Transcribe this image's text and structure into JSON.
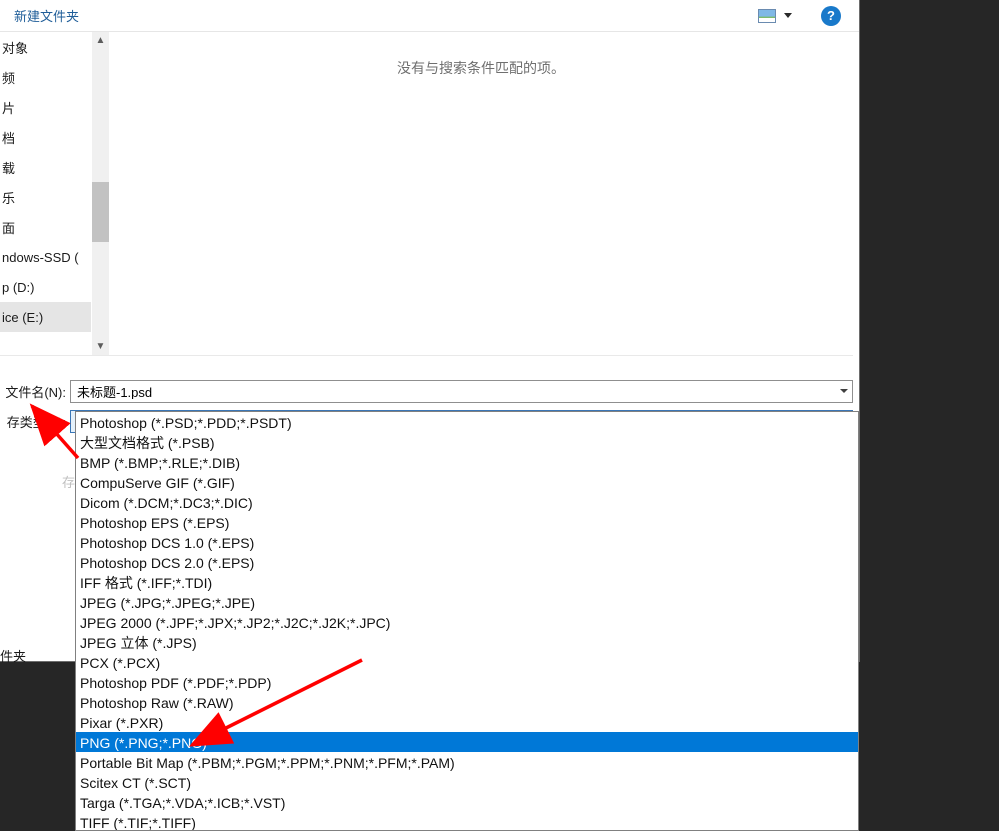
{
  "toolbar": {
    "new_folder": "新建文件夹"
  },
  "content": {
    "empty_message": "没有与搜索条件匹配的项。"
  },
  "nav": {
    "items": [
      " 对象",
      "频",
      "片",
      "档",
      "载",
      "乐",
      "面",
      "ndows-SSD (",
      "p (D:)",
      "ice (E:)"
    ],
    "selected_index": 9
  },
  "form": {
    "filename_label": "文件名(N):",
    "filename_value": "未标题-1.psd",
    "savetype_label": "存类型(T):",
    "savetype_value": "Photoshop (*.PSD;*.PDD;*.PSDT)",
    "hidden_char": "存",
    "side_label": "件夹"
  },
  "dropdown": {
    "highlight_index": 16,
    "options": [
      "Photoshop (*.PSD;*.PDD;*.PSDT)",
      "大型文档格式 (*.PSB)",
      "BMP (*.BMP;*.RLE;*.DIB)",
      "CompuServe GIF (*.GIF)",
      "Dicom (*.DCM;*.DC3;*.DIC)",
      "Photoshop EPS (*.EPS)",
      "Photoshop DCS 1.0 (*.EPS)",
      "Photoshop DCS 2.0 (*.EPS)",
      "IFF 格式 (*.IFF;*.TDI)",
      "JPEG (*.JPG;*.JPEG;*.JPE)",
      "JPEG 2000 (*.JPF;*.JPX;*.JP2;*.J2C;*.J2K;*.JPC)",
      "JPEG 立体 (*.JPS)",
      "PCX (*.PCX)",
      "Photoshop PDF (*.PDF;*.PDP)",
      "Photoshop Raw (*.RAW)",
      "Pixar (*.PXR)",
      "PNG (*.PNG;*.PNG)",
      "Portable Bit Map (*.PBM;*.PGM;*.PPM;*.PNM;*.PFM;*.PAM)",
      "Scitex CT (*.SCT)",
      "Targa (*.TGA;*.VDA;*.ICB;*.VST)",
      "TIFF (*.TIF;*.TIFF)"
    ]
  }
}
